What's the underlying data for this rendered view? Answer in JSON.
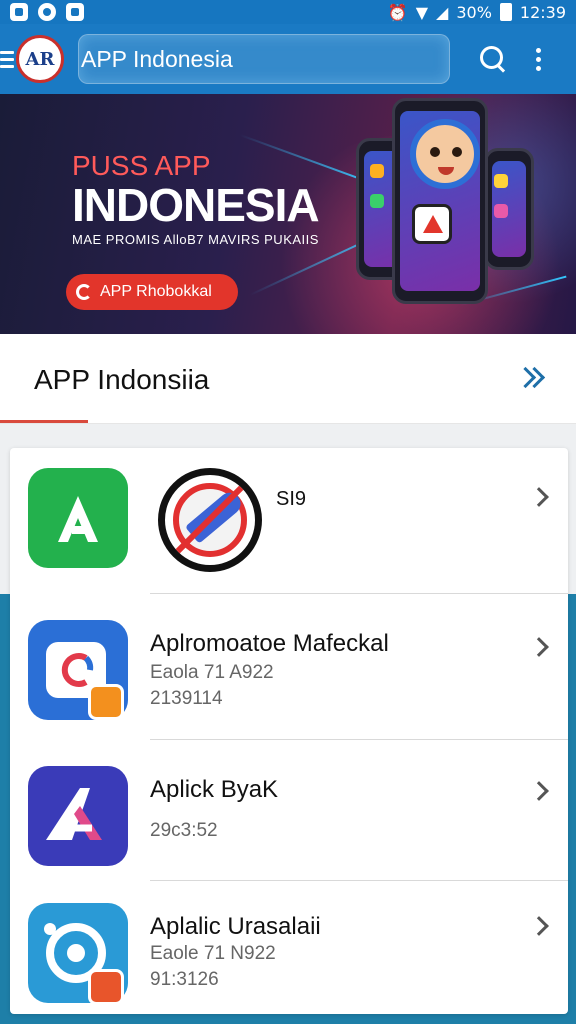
{
  "status_bar": {
    "battery": "30%",
    "time": "12:39"
  },
  "app_bar": {
    "logo_text": "AR",
    "title": "APP Indonesia"
  },
  "banner": {
    "subtitle": "PUSS APP",
    "title": "INDONESIA",
    "tagline": "MAE PROMIS AlloB7 MAVIRS PUKAIIS",
    "cta_label": "APP Rhobokkal"
  },
  "section": {
    "title": "APP Indonsiia"
  },
  "apps": [
    {
      "title": "SI9",
      "line1": "",
      "line2": "",
      "icon_color": "#23b14d"
    },
    {
      "title": "Aplromoatoe Mafeckal",
      "line1": "Eaola 71 A922",
      "line2": "2139114",
      "icon_color": "#2b6fd6"
    },
    {
      "title": "Aplick ByaK",
      "line1": "",
      "line2": "29c3:52",
      "icon_color": "#3a3bb8"
    },
    {
      "title": "Aplalic Urasalaii",
      "line1": "Eaole 71 N922",
      "line2": "91:3126",
      "icon_color": "#2a9ad6"
    }
  ]
}
